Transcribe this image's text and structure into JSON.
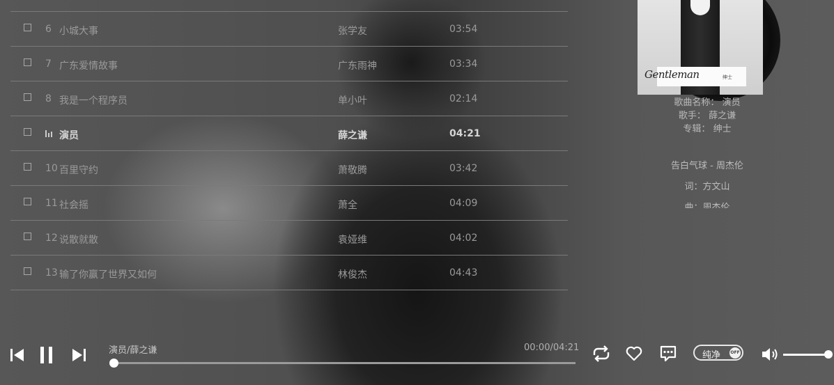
{
  "playlist": {
    "rows": [
      {
        "num": "6",
        "title": "小城大事",
        "artist": "张学友",
        "duration": "03:54",
        "active": false
      },
      {
        "num": "7",
        "title": "广东爱情故事",
        "artist": "广东雨神",
        "duration": "03:34",
        "active": false
      },
      {
        "num": "8",
        "title": "我是一个程序员",
        "artist": "单小叶",
        "duration": "02:14",
        "active": false
      },
      {
        "num": "",
        "title": "演员",
        "artist": "薛之谦",
        "duration": "04:21",
        "active": true
      },
      {
        "num": "10",
        "title": "百里守约",
        "artist": "萧敬腾",
        "duration": "03:42",
        "active": false
      },
      {
        "num": "11",
        "title": "社会摇",
        "artist": "萧全",
        "duration": "04:09",
        "active": false
      },
      {
        "num": "12",
        "title": "说散就散",
        "artist": "袁娅维",
        "duration": "04:02",
        "active": false
      },
      {
        "num": "13",
        "title": "输了你赢了世界又如何",
        "artist": "林俊杰",
        "duration": "04:43",
        "active": false
      }
    ]
  },
  "album": {
    "signature_text": "Gentleman",
    "tag_text": "绅士"
  },
  "song_info": {
    "name_label": "歌曲名称：",
    "name_value": "演员",
    "singer_label": "歌手：",
    "singer_value": "薛之谦",
    "album_label": "专辑：",
    "album_value": "绅士"
  },
  "lyrics": [
    "告白气球 - 周杰伦",
    "词：方文山",
    "曲：周杰伦"
  ],
  "player": {
    "now_playing": "演员/薛之谦",
    "time": "00:00/04:21",
    "progress": 0,
    "pure_mode_label": "纯净",
    "pure_mode_state": "OFF",
    "volume": 1.0
  },
  "icons": {
    "prev": "skip-back-icon",
    "pause": "pause-icon",
    "next": "skip-forward-icon",
    "loop": "repeat-icon",
    "like": "heart-icon",
    "comment": "comment-icon",
    "volume": "volume-icon"
  },
  "colors": {
    "active_text": "#d5d5d5",
    "inactive_text": "#9a9a9a",
    "divider": "#7a7a7a"
  }
}
